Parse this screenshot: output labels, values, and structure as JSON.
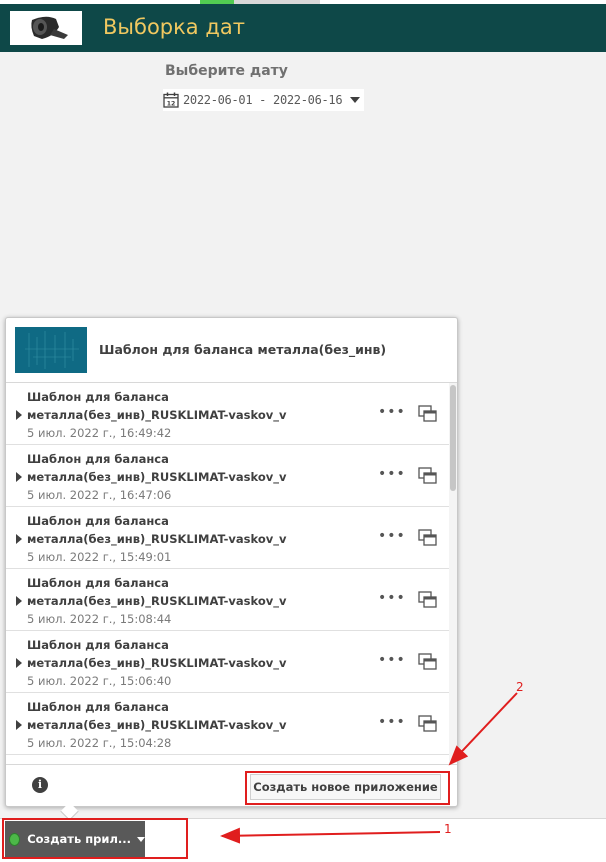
{
  "header": {
    "app_title": "Выборка дат",
    "colors": {
      "bg": "#0e4848",
      "title": "#f0c860"
    }
  },
  "filter": {
    "title": "Выберите дату",
    "date_range": "2022-06-01 - 2022-06-16",
    "icon": "calendar-icon"
  },
  "popup": {
    "title": "Шаблон для баланса металла(без_инв)",
    "items": [
      {
        "line1": "Шаблон для баланса",
        "line2": "металла(без_инв)_RUSKLIMAT-vaskov_v",
        "date": "5 июл. 2022 г., 16:49:42"
      },
      {
        "line1": "Шаблон для баланса",
        "line2": "металла(без_инв)_RUSKLIMAT-vaskov_v",
        "date": "5 июл. 2022 г., 16:47:06"
      },
      {
        "line1": "Шаблон для баланса",
        "line2": "металла(без_инв)_RUSKLIMAT-vaskov_v",
        "date": "5 июл. 2022 г., 15:49:01"
      },
      {
        "line1": "Шаблон для баланса",
        "line2": "металла(без_инв)_RUSKLIMAT-vaskov_v",
        "date": "5 июл. 2022 г., 15:08:44"
      },
      {
        "line1": "Шаблон для баланса",
        "line2": "металла(без_инв)_RUSKLIMAT-vaskov_v",
        "date": "5 июл. 2022 г., 15:06:40"
      },
      {
        "line1": "Шаблон для баланса",
        "line2": "металла(без_инв)_RUSKLIMAT-vaskov_v",
        "date": "5 июл. 2022 г., 15:04:28"
      }
    ],
    "create_new_label": "Создать новое приложение",
    "info_glyph": "i"
  },
  "bottom": {
    "create_app_label": "Создать прил..."
  },
  "annotations": {
    "one": "1",
    "two": "2",
    "color": "#e01e1e"
  }
}
